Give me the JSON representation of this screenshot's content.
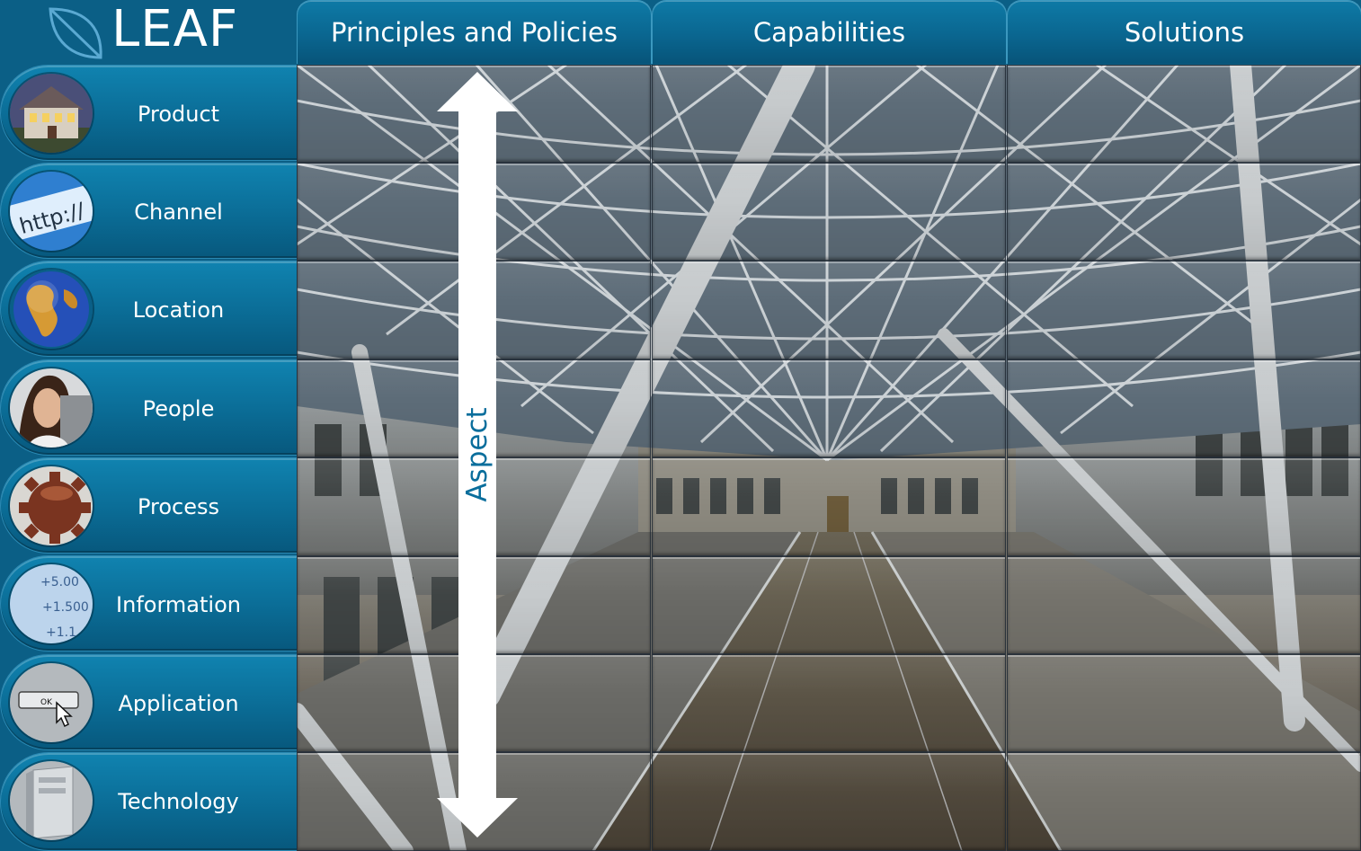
{
  "logo": {
    "text": "LEAF"
  },
  "columns": [
    {
      "label": "Principles and Policies"
    },
    {
      "label": "Capabilities"
    },
    {
      "label": "Solutions"
    }
  ],
  "rows": [
    {
      "label": "Product",
      "icon": "house-icon"
    },
    {
      "label": "Channel",
      "icon": "http-address-icon",
      "icon_text": "http://"
    },
    {
      "label": "Location",
      "icon": "globe-icon"
    },
    {
      "label": "People",
      "icon": "person-icon"
    },
    {
      "label": "Process",
      "icon": "gear-icon"
    },
    {
      "label": "Information",
      "icon": "numbers-icon",
      "icon_text": [
        "+5.00",
        "+1.500",
        "+1.1"
      ]
    },
    {
      "label": "Application",
      "icon": "ok-button-cursor-icon",
      "icon_text": "OK"
    },
    {
      "label": "Technology",
      "icon": "server-tower-icon"
    }
  ],
  "aspect": {
    "label": "Aspect"
  },
  "colors": {
    "primary": "#0b6e98",
    "header": "#0a6690",
    "arrow": "#ffffff",
    "aspect_text": "#0a6e9c"
  }
}
